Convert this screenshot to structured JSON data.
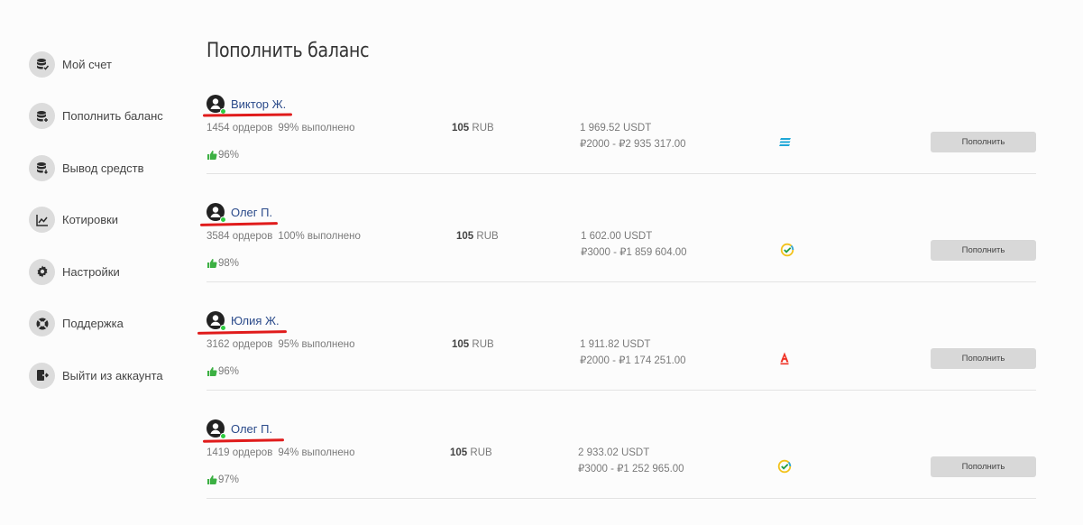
{
  "page": {
    "title": "Пополнить баланс"
  },
  "sidebar": {
    "items": [
      {
        "label": "Мой счет",
        "icon": "coins-check-icon"
      },
      {
        "label": "Пополнить баланс",
        "icon": "coins-plus-icon"
      },
      {
        "label": "Вывод средств",
        "icon": "coins-out-icon"
      },
      {
        "label": "Котировки",
        "icon": "chart-line-icon"
      },
      {
        "label": "Настройки",
        "icon": "gear-icon"
      },
      {
        "label": "Поддержка",
        "icon": "lifebuoy-icon"
      },
      {
        "label": "Выйти из аккаунта",
        "icon": "logout-icon"
      }
    ]
  },
  "offers": [
    {
      "name": "Виктор Ж.",
      "orders": "1454 ордеров",
      "completion": "99% выполнено",
      "rating": "96%",
      "price": "105",
      "currency": "RUB",
      "available": "1 969.52 USDT",
      "limits": "₽2000 - ₽2 935 317.00",
      "bank_icon": "bank-stripes-icon",
      "button": "Пополнить"
    },
    {
      "name": "Олег П.",
      "orders": "3584 ордеров",
      "completion": "100% выполнено",
      "rating": "98%",
      "price": "105",
      "currency": "RUB",
      "available": "1 602.00 USDT",
      "limits": "₽3000 - ₽1 859 604.00",
      "bank_icon": "sber-check-icon",
      "button": "Пополнить"
    },
    {
      "name": "Юлия Ж.",
      "orders": "3162 ордеров",
      "completion": "95% выполнено",
      "rating": "96%",
      "price": "105",
      "currency": "RUB",
      "available": "1 911.82 USDT",
      "limits": "₽2000 - ₽1 174 251.00",
      "bank_icon": "alfa-a-icon",
      "button": "Пополнить"
    },
    {
      "name": "Олег П.",
      "orders": "1419 ордеров",
      "completion": "94% выполнено",
      "rating": "97%",
      "price": "105",
      "currency": "RUB",
      "available": "2 933.02 USDT",
      "limits": "₽3000 - ₽1 252 965.00",
      "bank_icon": "sber-check-icon",
      "button": "Пополнить"
    }
  ],
  "colors": {
    "annotation_underline": "#e01b1b",
    "online": "#2ecc40",
    "username": "#2a4a8a",
    "button_bg": "#d8d8d8"
  }
}
